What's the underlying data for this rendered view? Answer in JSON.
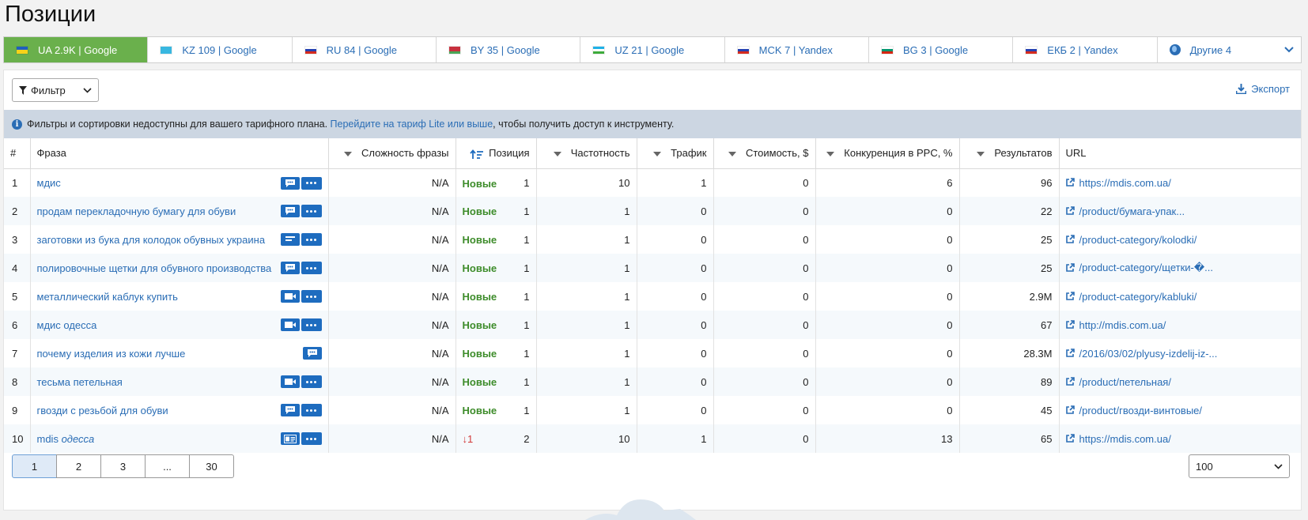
{
  "page_title": "Позиции",
  "tabs": [
    {
      "label": "UA 2.9K | Google",
      "flag": [
        "#1f5fbf",
        "#f7d21a"
      ],
      "active": true
    },
    {
      "label": "KZ 109 | Google",
      "flag": [
        "#38b7e0",
        "#38b7e0"
      ],
      "active": false
    },
    {
      "label": "RU 84 | Google",
      "flag": [
        "#ffffff",
        "#2541b2",
        "#d52b1e"
      ],
      "active": false
    },
    {
      "label": "BY 35 | Google",
      "flag": [
        "#c8313e",
        "#c8313e",
        "#4aa657"
      ],
      "active": false
    },
    {
      "label": "UZ 21 | Google",
      "flag": [
        "#1eb1e7",
        "#ffffff",
        "#3dab3b"
      ],
      "active": false
    },
    {
      "label": "MCK 7 | Yandex",
      "flag": [
        "#ffffff",
        "#2541b2",
        "#d52b1e"
      ],
      "active": false
    },
    {
      "label": "BG 3 | Google",
      "flag": [
        "#ffffff",
        "#00966e",
        "#d62612"
      ],
      "active": false
    },
    {
      "label": "ЕКБ 2 | Yandex",
      "flag": [
        "#ffffff",
        "#2541b2",
        "#d52b1e"
      ],
      "active": false
    },
    {
      "label": "Другие 4",
      "flag": [],
      "active": false
    }
  ],
  "toolbar": {
    "filter_label": "Фильтр",
    "export_label": "Экспорт"
  },
  "notice": {
    "text_before": "Фильтры и сортировки недоступны для вашего тарифного плана. ",
    "link": "Перейдите на тариф Lite или выше",
    "text_after": ", чтобы получить доступ к инструменту."
  },
  "table": {
    "headers": {
      "num": "#",
      "phrase": "Фраза",
      "difficulty": "Сложность фразы",
      "position": "Позиция",
      "frequency": "Частотность",
      "traffic": "Трафик",
      "cost": "Стоимость, $",
      "ppc": "Конкуренция в PPC, %",
      "results": "Результатов",
      "url": "URL"
    },
    "rows": [
      {
        "num": "1",
        "phrase": "мдис",
        "phrase_italic": "",
        "icon": "chat",
        "dots": true,
        "difficulty": "N/A",
        "change": "Новые",
        "change_type": "new",
        "position": "1",
        "frequency": "10",
        "traffic": "1",
        "cost": "0",
        "ppc": "6",
        "results": "96",
        "url": "https://mdis.com.ua/"
      },
      {
        "num": "2",
        "phrase": "продам перекладочную бумагу для обуви",
        "phrase_italic": "",
        "icon": "chat",
        "dots": true,
        "difficulty": "N/A",
        "change": "Новые",
        "change_type": "new",
        "position": "1",
        "frequency": "1",
        "traffic": "0",
        "cost": "0",
        "ppc": "0",
        "results": "22",
        "url": "/product/бумага-упак..."
      },
      {
        "num": "3",
        "phrase": "заготовки из бука для колодок обувных украина",
        "phrase_italic": "",
        "icon": "lines",
        "dots": true,
        "difficulty": "N/A",
        "change": "Новые",
        "change_type": "new",
        "position": "1",
        "frequency": "1",
        "traffic": "0",
        "cost": "0",
        "ppc": "0",
        "results": "25",
        "url": "/product-category/kolodki/"
      },
      {
        "num": "4",
        "phrase": "полировочные щетки для обувного производства",
        "phrase_italic": "",
        "icon": "chat",
        "dots": true,
        "difficulty": "N/A",
        "change": "Новые",
        "change_type": "new",
        "position": "1",
        "frequency": "1",
        "traffic": "0",
        "cost": "0",
        "ppc": "0",
        "results": "25",
        "url": "/product-category/щетки-�..."
      },
      {
        "num": "5",
        "phrase": "металлический каблук купить",
        "phrase_italic": "",
        "icon": "video",
        "dots": true,
        "difficulty": "N/A",
        "change": "Новые",
        "change_type": "new",
        "position": "1",
        "frequency": "1",
        "traffic": "0",
        "cost": "0",
        "ppc": "0",
        "results": "2.9M",
        "url": "/product-category/kabluki/"
      },
      {
        "num": "6",
        "phrase": "мдис одесса",
        "phrase_italic": "",
        "icon": "video",
        "dots": true,
        "difficulty": "N/A",
        "change": "Новые",
        "change_type": "new",
        "position": "1",
        "frequency": "1",
        "traffic": "0",
        "cost": "0",
        "ppc": "0",
        "results": "67",
        "url": "http://mdis.com.ua/"
      },
      {
        "num": "7",
        "phrase": "почему изделия из кожи лучше",
        "phrase_italic": "",
        "icon": "chat",
        "dots": false,
        "difficulty": "N/A",
        "change": "Новые",
        "change_type": "new",
        "position": "1",
        "frequency": "1",
        "traffic": "0",
        "cost": "0",
        "ppc": "0",
        "results": "28.3M",
        "url": "/2016/03/02/plyusy-izdelij-iz-..."
      },
      {
        "num": "8",
        "phrase": "тесьма петельная",
        "phrase_italic": "",
        "icon": "video",
        "dots": true,
        "difficulty": "N/A",
        "change": "Новые",
        "change_type": "new",
        "position": "1",
        "frequency": "1",
        "traffic": "0",
        "cost": "0",
        "ppc": "0",
        "results": "89",
        "url": "/product/петельная/"
      },
      {
        "num": "9",
        "phrase": "гвозди с резьбой для обуви",
        "phrase_italic": "",
        "icon": "chat",
        "dots": true,
        "difficulty": "N/A",
        "change": "Новые",
        "change_type": "new",
        "position": "1",
        "frequency": "1",
        "traffic": "0",
        "cost": "0",
        "ppc": "0",
        "results": "45",
        "url": "/product/гвозди-винтовые/"
      },
      {
        "num": "10",
        "phrase": "mdis ",
        "phrase_italic": "одесса",
        "icon": "card",
        "dots": true,
        "difficulty": "N/A",
        "change": "↓1",
        "change_type": "down",
        "position": "2",
        "frequency": "10",
        "traffic": "1",
        "cost": "0",
        "ppc": "13",
        "results": "65",
        "url": "https://mdis.com.ua/"
      }
    ]
  },
  "pagination": {
    "pages": [
      "1",
      "2",
      "3",
      "...",
      "30"
    ],
    "current": "1",
    "per_page": "100"
  },
  "colors": {
    "active_tab": "#6ab04c",
    "link": "#2a6db5",
    "new": "#3d8c2a",
    "down": "#d23a3a",
    "action": "#1e6cbf"
  }
}
